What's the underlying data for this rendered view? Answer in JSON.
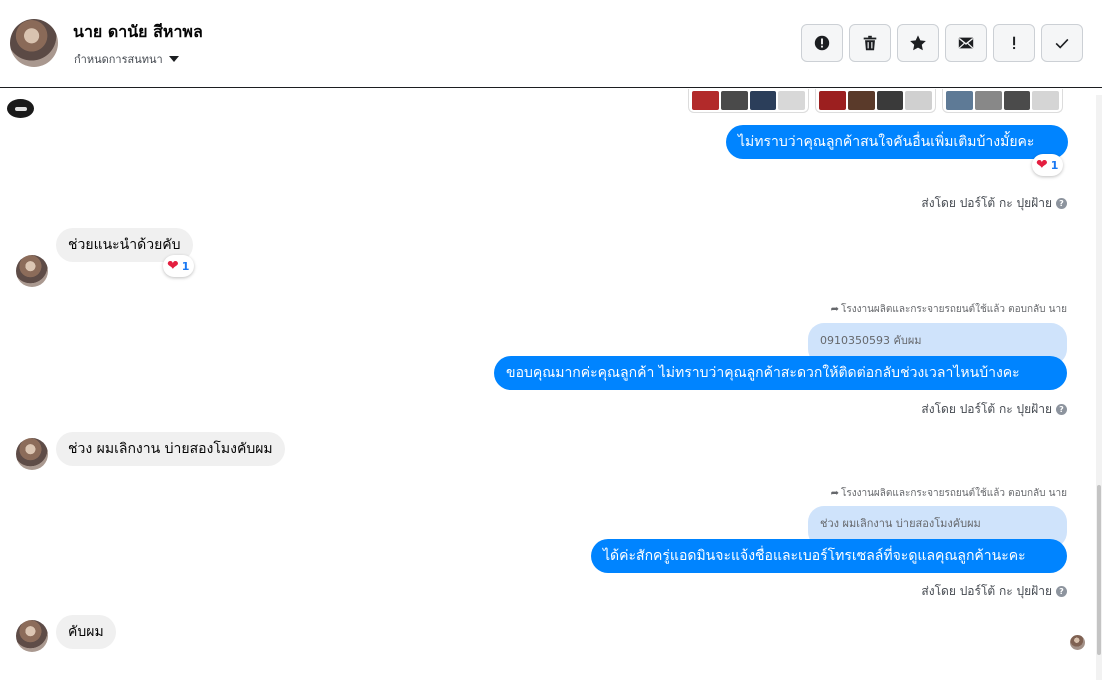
{
  "header": {
    "name": "นาย ดานัย สีหาพล",
    "assign_label": "กำหนดการสนทนา",
    "toolbar": [
      {
        "icon": "alert-circle-icon",
        "name": "report-button"
      },
      {
        "icon": "trash-icon",
        "name": "delete-button"
      },
      {
        "icon": "star-icon",
        "name": "star-button"
      },
      {
        "icon": "mail-icon",
        "name": "mark-unread-button"
      },
      {
        "icon": "exclamation-icon",
        "name": "mark-spam-button"
      },
      {
        "icon": "check-icon",
        "name": "mark-done-button"
      }
    ]
  },
  "messages": {
    "m1": {
      "text": "ไม่ทราบว่าคุณลูกค้าสนใจคันอื่นเพิ่มเติมบ้างมั้ยคะ",
      "reaction_count": "1",
      "meta": "ส่งโดย ปอร์โต้ กะ ปุยฝ้าย"
    },
    "m2": {
      "text": "ช่วยแนะนำด้วยคับ",
      "reaction_count": "1"
    },
    "m3": {
      "reply_note": "โรงงานผลิตและกระจายรถยนต์ใช้แล้ว ตอบกลับ นาย",
      "quote": "0910350593 คับผม",
      "text": "ขอบคุณมากค่ะคุณลูกค้า ไม่ทราบว่าคุณลูกค้าสะดวกให้ติดต่อกลับช่วงเวลาไหนบ้างคะ",
      "meta": "ส่งโดย ปอร์โต้ กะ ปุยฝ้าย"
    },
    "m4": {
      "text": "ช่วง ผมเลิกงาน บ่ายสองโมงคับผม"
    },
    "m5": {
      "reply_note": "โรงงานผลิตและกระจายรถยนต์ใช้แล้ว ตอบกลับ นาย",
      "quote": "ช่วง ผมเลิกงาน บ่ายสองโมงคับผม",
      "text": "ได้ค่ะสักครู่แอดมินจะแจ้งชื่อและเบอร์โทรเซลล์ที่จะดูแลคุณลูกค้านะคะ",
      "meta": "ส่งโดย ปอร์โต้ กะ ปุยฝ้าย"
    },
    "m6": {
      "text": "คับผม"
    }
  },
  "colors": {
    "outgoing": "#0084ff",
    "incoming": "#f0f0f0",
    "quote": "#cfe3fb",
    "heart": "#e41e3f"
  }
}
